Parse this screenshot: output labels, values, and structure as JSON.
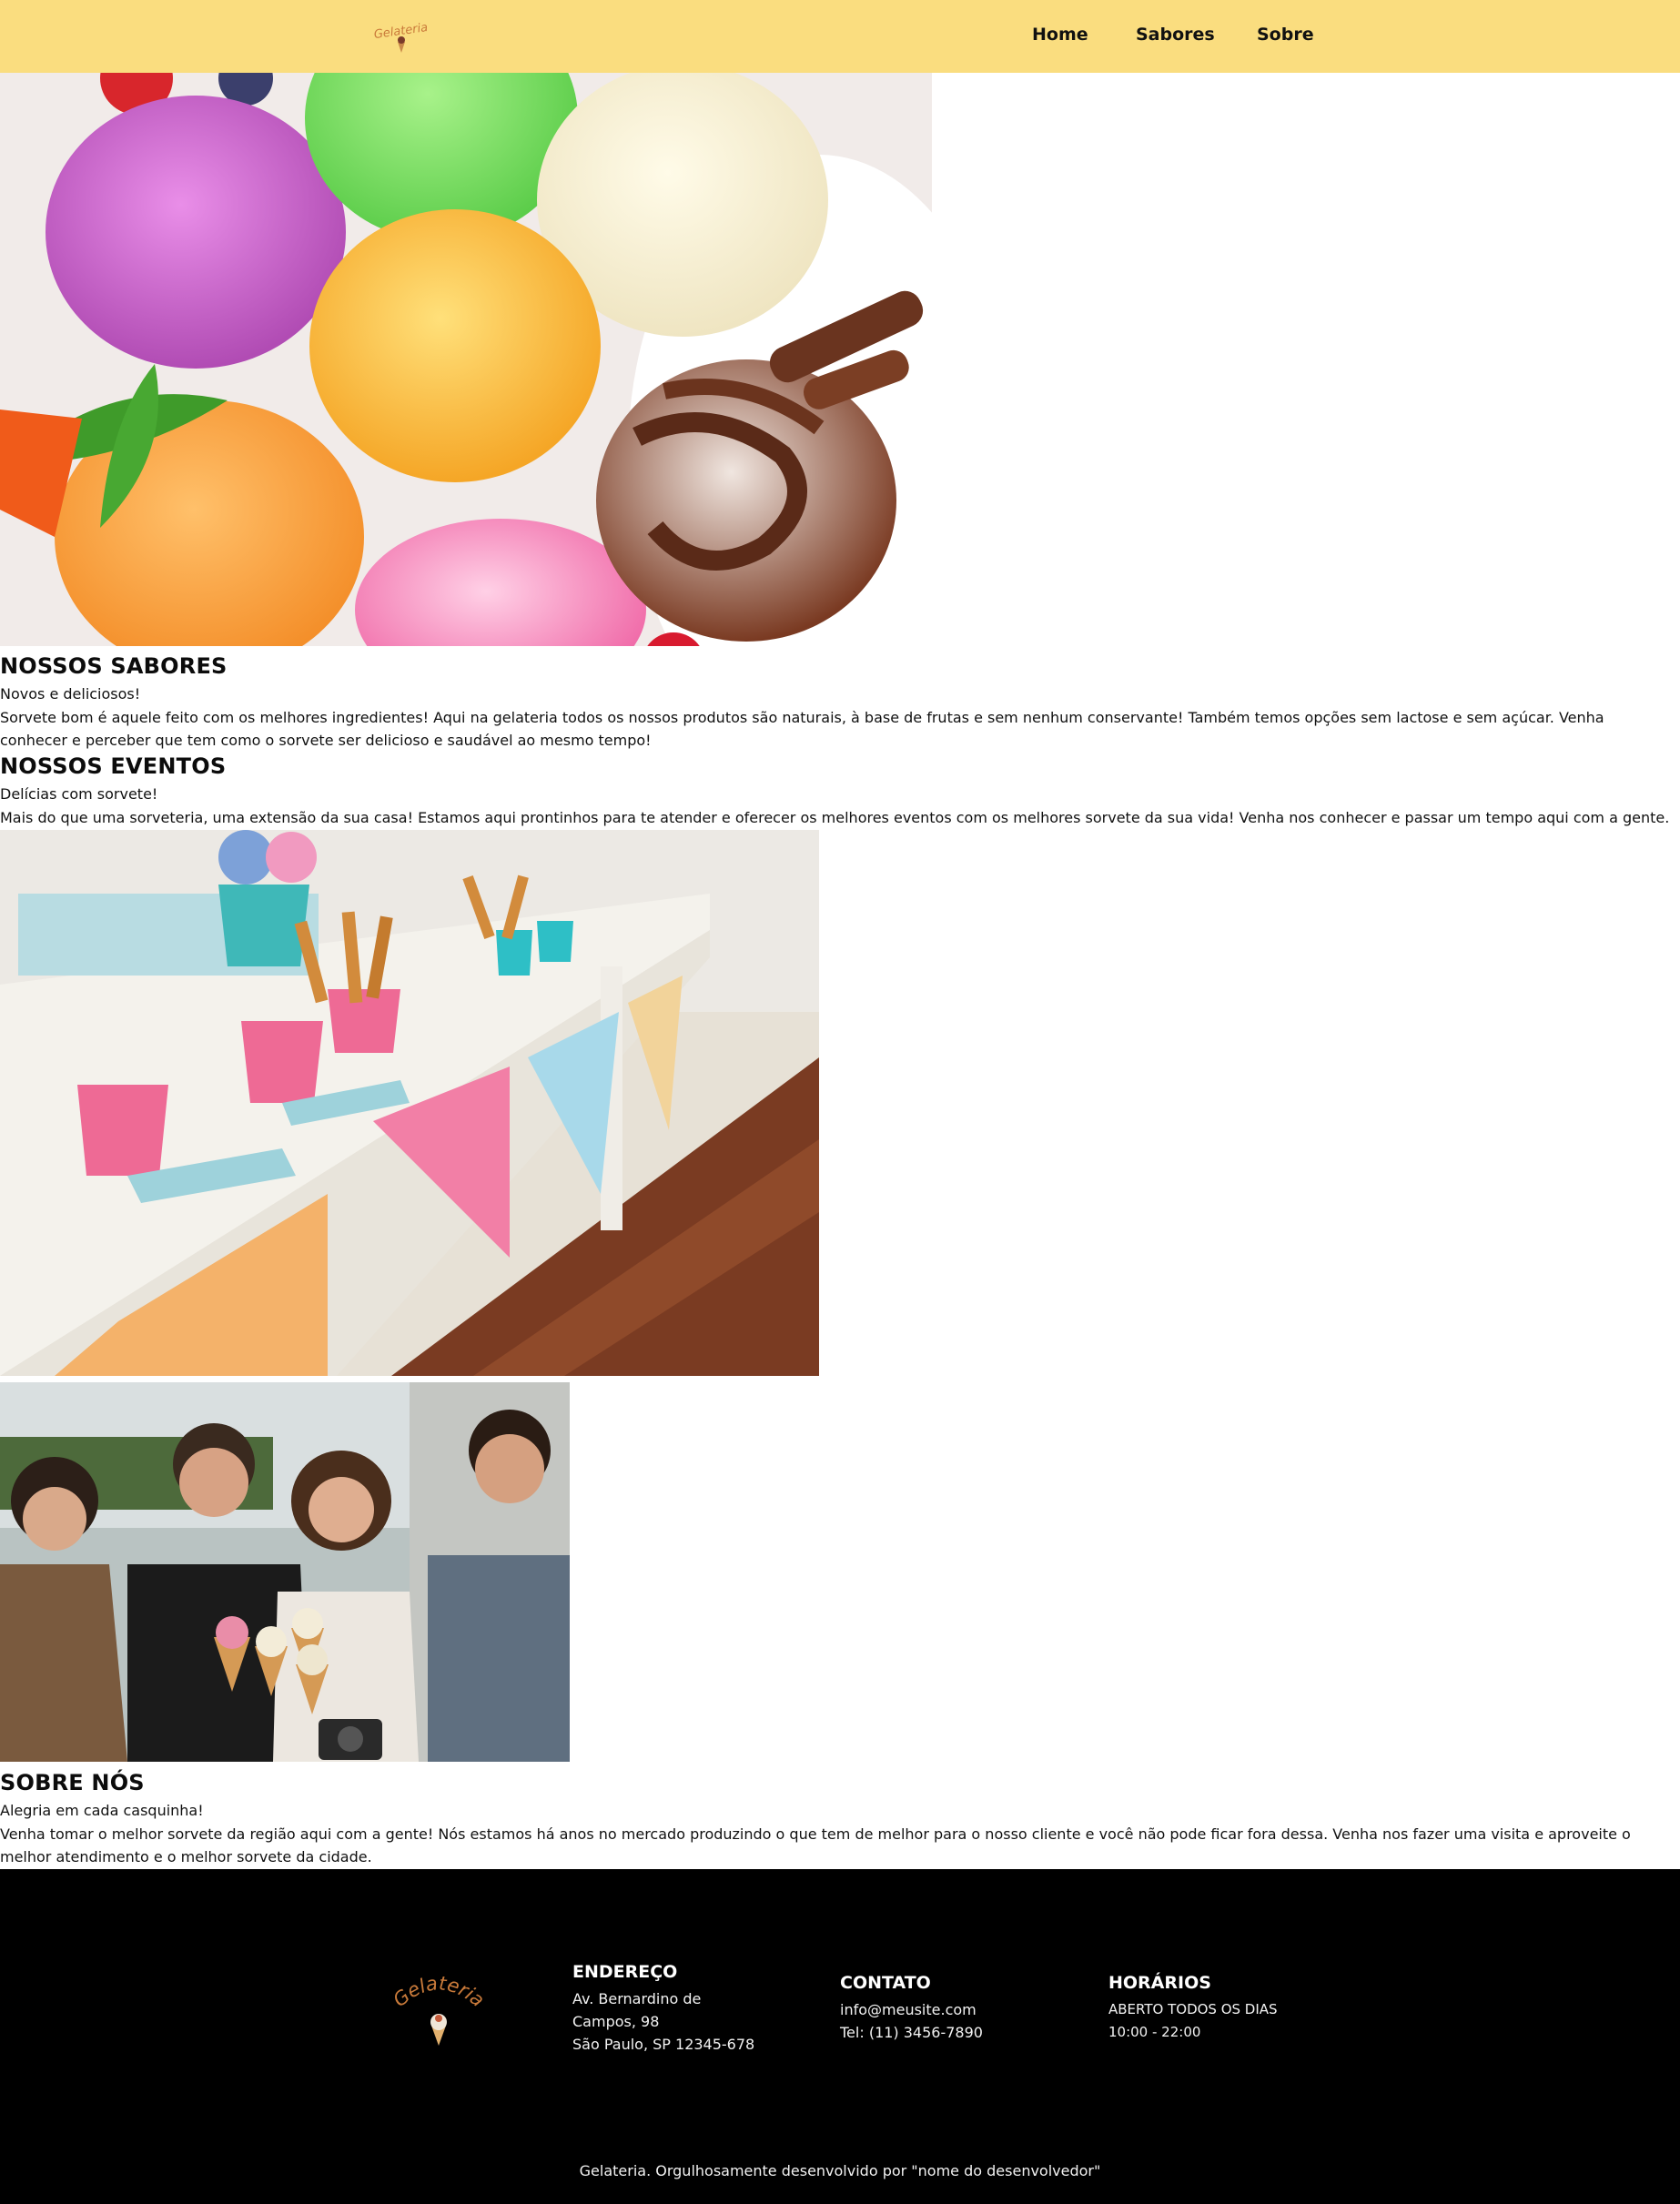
{
  "brand": {
    "logo_text": "Gelateria",
    "accent": "#c97a3a",
    "header_bg": "#fadd7f"
  },
  "nav": {
    "items": [
      {
        "label": "Home"
      },
      {
        "label": "Sabores"
      },
      {
        "label": "Sobre"
      }
    ]
  },
  "flavors": {
    "title": "NOSSOS SABORES",
    "subtitle": "Novos e deliciosos!",
    "text_line1": "Sorvete bom é aquele feito com os melhores ingredientes! Aqui na gelateria todos os nossos produtos são naturais, à base de frutas e sem nenhum conservante! Também temos opções sem lactose e sem açúcar. Venha",
    "text_line2": "conhecer e perceber que tem como o sorvete ser delicioso e saudável ao mesmo tempo!"
  },
  "events": {
    "title": "NOSSOS EVENTOS",
    "subtitle": "Delícias com sorvete!",
    "text": "Mais do que uma sorveteria, uma extensão da sua casa! Estamos aqui prontinhos para te atender e oferecer os melhores eventos com os melhores sorvete da sua vida! Venha nos conhecer e passar um tempo aqui com a gente."
  },
  "about": {
    "title": "SOBRE NÓS",
    "subtitle": "Alegria em cada casquinha!",
    "text_line1": "Venha tomar o melhor sorvete da região aqui com a gente! Nós estamos há anos no mercado produzindo o que tem de melhor para o nosso cliente e você não pode ficar fora dessa. Venha nos fazer uma visita e aproveite o",
    "text_line2": "melhor atendimento e o melhor sorvete da cidade."
  },
  "footer": {
    "address": {
      "title": "ENDEREÇO",
      "line1": "Av. Bernardino de",
      "line2": "Campos, 98",
      "line3": "São Paulo, SP 12345-678"
    },
    "contact": {
      "title": "CONTATO",
      "email": "info@meusite.com",
      "phone": "Tel: (11) 3456-7890"
    },
    "hours": {
      "title": "HORÁRIOS",
      "line1": "ABERTO TODOS OS DIAS",
      "line2": "10:00 - 22:00"
    },
    "credits": "Gelateria. Orgulhosamente desenvolvido por \"nome do desenvolvedor\""
  }
}
